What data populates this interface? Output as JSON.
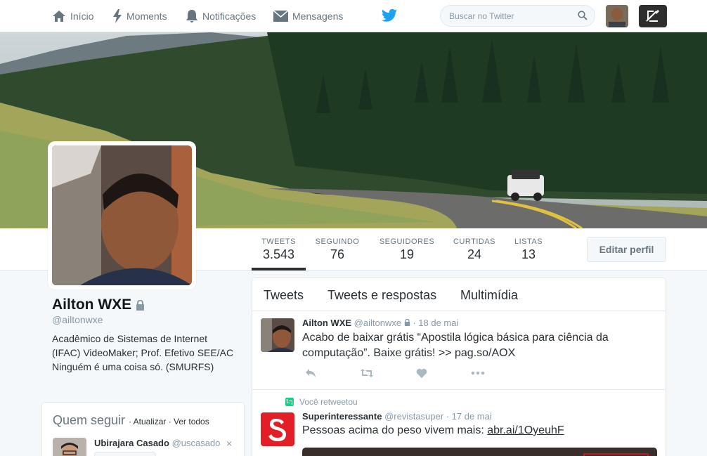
{
  "nav": {
    "home": "Início",
    "moments": "Moments",
    "notifications": "Notificações",
    "messages": "Mensagens",
    "search_placeholder": "Buscar no Twitter"
  },
  "profile": {
    "name": "Ailton WXE",
    "handle": "@ailtonwxe",
    "bio": "Acadêmico de Sistemas de Internet (IFAC) VideoMaker; Prof. Efetivo SEE/AC Ninguém é uma coisa só. (SMURFS)",
    "edit_label": "Editar perfil"
  },
  "stats": [
    {
      "label": "TWEETS",
      "value": "3.543"
    },
    {
      "label": "SEGUINDO",
      "value": "76"
    },
    {
      "label": "SEGUIDORES",
      "value": "19"
    },
    {
      "label": "CURTIDAS",
      "value": "24"
    },
    {
      "label": "LISTAS",
      "value": "13"
    }
  ],
  "who_to_follow": {
    "title": "Quem seguir",
    "refresh": "Atualizar",
    "view_all": "Ver todos",
    "user_name": "Ubirajara Casado",
    "user_handle": "@uscasado",
    "close": "×"
  },
  "timeline": {
    "tabs": [
      "Tweets",
      "Tweets e respostas",
      "Multimídia"
    ],
    "tweet1": {
      "name": "Ailton WXE",
      "handle": "@ailtonwxe",
      "date": "· 18 de mai",
      "text": "Acabo de baixar grátis “Apostila lógica básica para ciência da computação”. Baixe grátis! >> pag.so/AOX"
    },
    "tweet2": {
      "context": "Você retweetou",
      "name": "Superinteressante",
      "handle": "@revistasuper",
      "date": "· 17 de mai",
      "text": "Pessoas acima do peso vivem mais:",
      "link": "abr.ai/1OyeuhF"
    }
  },
  "colors": {
    "brand": "#1da1f2",
    "super_red": "#e21f26",
    "retweet_green": "#19cf86"
  }
}
